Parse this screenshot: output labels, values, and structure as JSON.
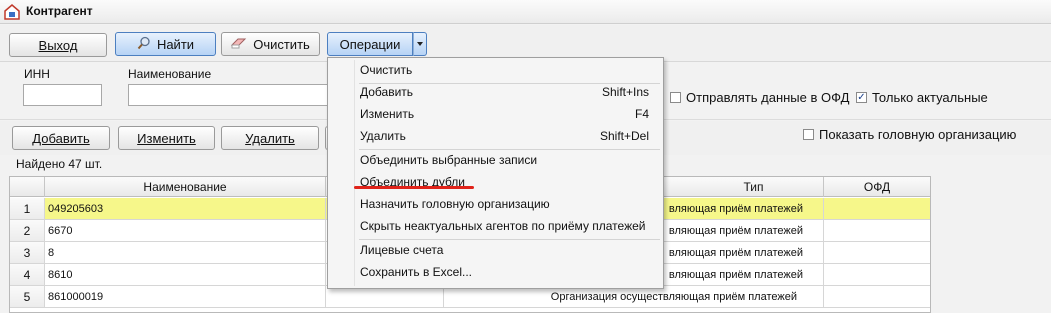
{
  "window": {
    "title": "Контрагент"
  },
  "toolbar": {
    "exit": "Выход",
    "find": "Найти",
    "clear": "Очистить",
    "operations": "Операции"
  },
  "filters": {
    "inn_label": "ИНН",
    "name_label": "Наименование",
    "send_ofd_label": "Отправлять данные в ОФД",
    "send_ofd_checked": false,
    "only_actual_label": "Только актуальные",
    "only_actual_checked": true
  },
  "actions": {
    "add": "Добавить",
    "edit": "Изменить",
    "delete": "Удалить",
    "show_head_org": "Показать головную организацию",
    "show_head_org_checked": false
  },
  "status": {
    "found": "Найдено 47 шт."
  },
  "grid": {
    "columns": [
      "Наименование",
      "Тип",
      "ОФД"
    ],
    "rows": [
      {
        "n": "1",
        "name": "049205603",
        "type": "вляющая приём платежей",
        "ofd": ""
      },
      {
        "n": "2",
        "name": "6670",
        "type": "вляющая приём платежей",
        "ofd": ""
      },
      {
        "n": "3",
        "name": "8",
        "type": "вляющая приём платежей",
        "ofd": ""
      },
      {
        "n": "4",
        "name": "8610",
        "type": "вляющая приём платежей",
        "ofd": ""
      },
      {
        "n": "5",
        "name": "861000019",
        "type": "Организация осуществляющая приём платежей",
        "ofd": ""
      }
    ]
  },
  "menu": {
    "items": [
      {
        "label": "Очистить",
        "shortcut": ""
      },
      {
        "label": "Добавить",
        "shortcut": "Shift+Ins"
      },
      {
        "label": "Изменить",
        "shortcut": "F4"
      },
      {
        "label": "Удалить",
        "shortcut": "Shift+Del"
      },
      {
        "label": "Объединить выбранные записи",
        "shortcut": ""
      },
      {
        "label": "Объединить дубли",
        "shortcut": ""
      },
      {
        "label": "Назначить головную организацию",
        "shortcut": ""
      },
      {
        "label": "Скрыть неактуальных агентов по приёму платежей",
        "shortcut": ""
      },
      {
        "label": "Лицевые счета",
        "shortcut": ""
      },
      {
        "label": "Сохранить в Excel...",
        "shortcut": ""
      }
    ]
  },
  "colors": {
    "selected_row": "#f6f78a",
    "accent_blue": "#b6d3f5",
    "highlight_mark": "#e0231a"
  }
}
